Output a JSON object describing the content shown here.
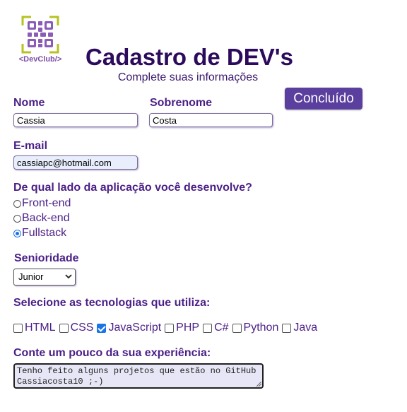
{
  "logo": {
    "text": "<DevClub/>"
  },
  "header": {
    "title": "Cadastro de DEV's",
    "subtitle": "Complete suas informações"
  },
  "actions": {
    "done_label": "Concluído"
  },
  "form": {
    "first_name": {
      "label": "Nome",
      "value": "Cassia"
    },
    "last_name": {
      "label": "Sobrenome",
      "value": "Costa"
    },
    "email": {
      "label": "E-mail",
      "value": "cassiapc@hotmail.com"
    },
    "side": {
      "question": "De qual lado da aplicação você desenvolve?",
      "options": [
        "Front-end",
        "Back-end",
        "Fullstack"
      ],
      "selected": "Fullstack"
    },
    "seniority": {
      "label": "Senioridade",
      "selected": "Junior"
    },
    "technologies": {
      "label": "Selecione as tecnologias que utiliza:",
      "items": [
        "HTML",
        "CSS",
        "JavaScript",
        "PHP",
        "C#",
        "Python",
        "Java"
      ],
      "checked": [
        "JavaScript"
      ]
    },
    "experience": {
      "label": "Conte um pouco da sua experiência:",
      "line1": "Tenho feito alguns projetos que estão no GitHub",
      "line2": "Cassiacosta10 ;-)"
    }
  },
  "colors": {
    "accent": "#5b3f9e",
    "title": "#2c0a5c",
    "label": "#4b1f86",
    "logo_lime": "#b5c21f",
    "logo_purple": "#7b4fa8"
  }
}
